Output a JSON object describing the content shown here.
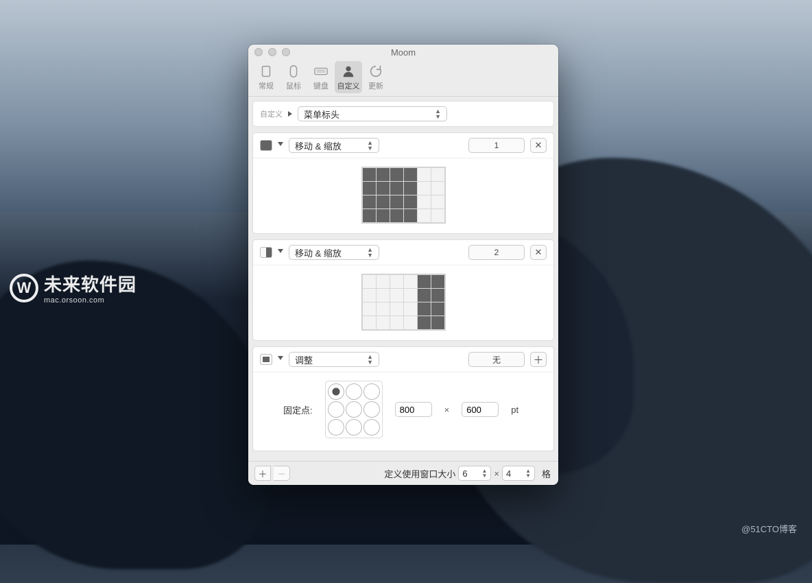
{
  "window_title": "Moom",
  "toolbar": {
    "items": [
      {
        "label": "常规"
      },
      {
        "label": "鼠标"
      },
      {
        "label": "键盘"
      },
      {
        "label": "自定义"
      },
      {
        "label": "更新"
      }
    ],
    "active_index": 3
  },
  "header_card": {
    "small_label": "自定义",
    "dropdown": "菜单标头"
  },
  "actions": [
    {
      "dropdown": "移动 & 缩放",
      "hotkey": "1",
      "grid": {
        "cols": 6,
        "rows": 4,
        "on": [
          [
            0,
            0
          ],
          [
            0,
            1
          ],
          [
            0,
            2
          ],
          [
            0,
            3
          ],
          [
            1,
            0
          ],
          [
            1,
            1
          ],
          [
            1,
            2
          ],
          [
            1,
            3
          ],
          [
            2,
            0
          ],
          [
            2,
            1
          ],
          [
            2,
            2
          ],
          [
            2,
            3
          ],
          [
            3,
            0
          ],
          [
            3,
            1
          ],
          [
            3,
            2
          ],
          [
            3,
            3
          ]
        ]
      }
    },
    {
      "dropdown": "移动 & 缩放",
      "hotkey": "2",
      "grid": {
        "cols": 6,
        "rows": 4,
        "on": [
          [
            0,
            4
          ],
          [
            0,
            5
          ],
          [
            1,
            4
          ],
          [
            1,
            5
          ],
          [
            2,
            4
          ],
          [
            2,
            5
          ],
          [
            3,
            4
          ],
          [
            3,
            5
          ]
        ]
      }
    }
  ],
  "resize_card": {
    "dropdown": "调整",
    "hotkey": "无",
    "anchor_label": "固定点:",
    "anchor_selected": 0,
    "width": "800",
    "height": "600",
    "unit": "pt"
  },
  "footer": {
    "label": "定义使用窗口大小",
    "cols": "6",
    "rows": "4",
    "suffix": "格",
    "mult": "×"
  },
  "watermark_left": {
    "brand": "未来软件园",
    "sub": "mac.orsoon.com"
  },
  "watermark_br": "@51CTO博客"
}
